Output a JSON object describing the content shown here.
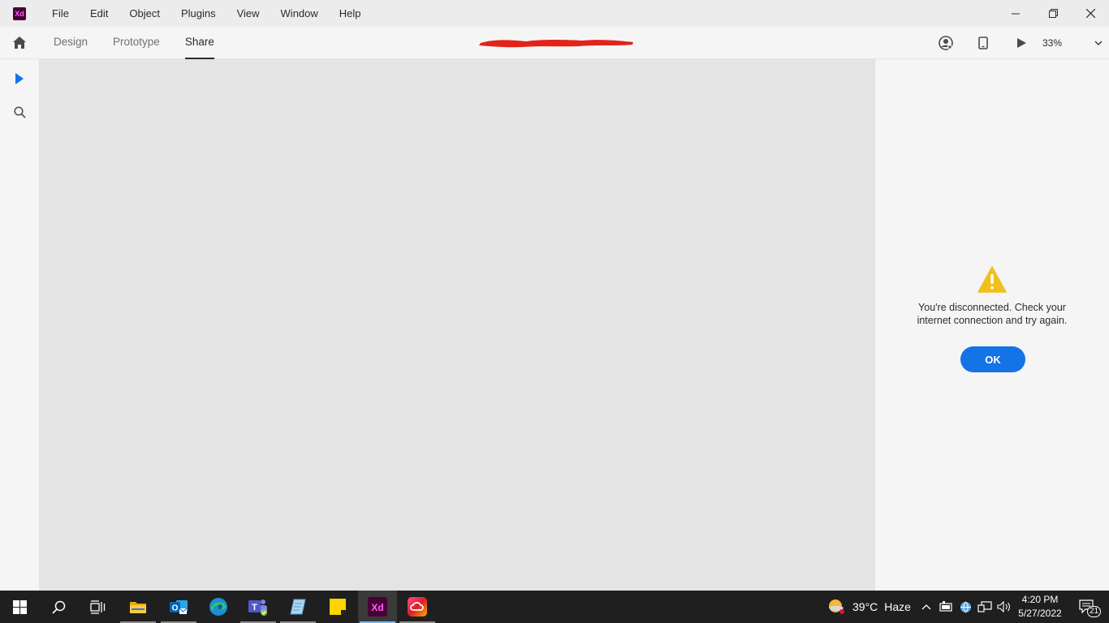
{
  "titlebar": {
    "app_logo": "Xd",
    "menu": [
      "File",
      "Edit",
      "Object",
      "Plugins",
      "View",
      "Window",
      "Help"
    ],
    "window_controls": [
      "minimize-icon",
      "restore-icon",
      "close-icon"
    ]
  },
  "modebar": {
    "tabs": [
      {
        "label": "Design",
        "active": false
      },
      {
        "label": "Prototype",
        "active": false
      },
      {
        "label": "Share",
        "active": true
      }
    ],
    "zoom": "33%"
  },
  "dialog": {
    "message_line1": "You're disconnected. Check your",
    "message_line2": "internet connection and try again.",
    "ok_label": "OK"
  },
  "taskbar": {
    "weather_temp": "39°C",
    "weather_text": "Haze",
    "time": "4:20 PM",
    "date": "5/27/2022",
    "notification_count": "21"
  },
  "colors": {
    "accent": "#1473e6",
    "warning": "#f2c01c",
    "xd_brand": "#470137",
    "redaction": "#e2231a"
  }
}
